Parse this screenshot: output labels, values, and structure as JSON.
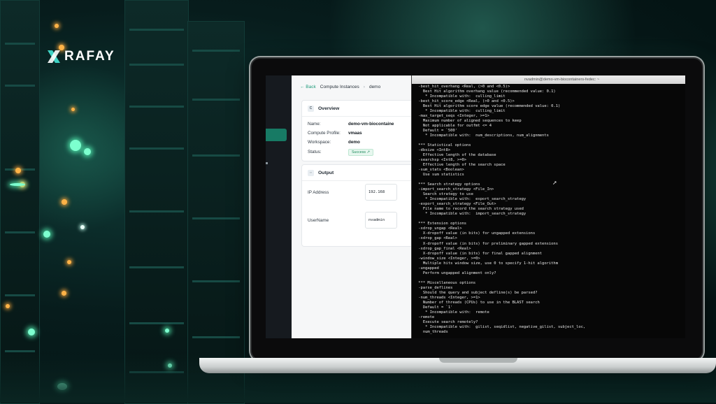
{
  "brand": {
    "name": "RAFAY"
  },
  "console": {
    "breadcrumb": {
      "back": "← Back",
      "section": "Compute Instances",
      "current": "demo"
    },
    "overview": {
      "title": "Overview",
      "rows": [
        {
          "label": "Name:",
          "value": "demo-vm-biocontaine"
        },
        {
          "label": "Compute Profile:",
          "value": "vmaas"
        },
        {
          "label": "Workspace:",
          "value": "demo"
        }
      ],
      "status_label": "Status:",
      "status_value": "Success ↗"
    },
    "output": {
      "title": "Output",
      "ip_label": "IP Address",
      "ip_value": "192.168",
      "user_label": "UserName",
      "user_value": "nvadmin"
    }
  },
  "terminal": {
    "title": "nvadmin@demo-vm-biocontainers-fedec: ~",
    "lines": [
      " -best_hit_overhang <Real, (>0 and <0.5)>",
      "   Best Hit algorithm overhang value (recommended value: 0.1)",
      "    * Incompatible with:  culling_limit",
      " -best_hit_score_edge <Real, (>0 and <0.5)>",
      "   Best Hit algorithm score edge value (recommended value: 0.1)",
      "    * Incompatible with:  culling_limit",
      " -max_target_seqs <Integer, >=1>",
      "   Maximum number of aligned sequences to keep",
      "   Not applicable for outfmt <= 4",
      "   Default = `500'",
      "    * Incompatible with:  num_descriptions, num_alignments",
      "",
      " *** Statistical options",
      " -dbsize <Int8>",
      "   Effective length of the database",
      " -searchsp <Int8, >=0>",
      "   Effective length of the search space",
      " -sum_stats <Boolean>",
      "   Use sum statistics",
      "",
      " *** Search strategy options",
      " -import_search_strategy <File_In>",
      "   Search strategy to use",
      "    * Incompatible with:  export_search_strategy",
      " -export_search_strategy <File_Out>",
      "   File name to record the search strategy used",
      "    * Incompatible with:  import_search_strategy",
      "",
      " *** Extension options",
      " -xdrop_ungap <Real>",
      "   X-dropoff value (in bits) for ungapped extensions",
      " -xdrop_gap <Real>",
      "   X-dropoff value (in bits) for preliminary gapped extensions",
      " -xdrop_gap_final <Real>",
      "   X-dropoff value (in bits) for final gapped alignment",
      " -window_size <Integer, >=0>",
      "   Multiple hits window size, use 0 to specify 1-hit algorithm",
      " -ungapped",
      "   Perform ungapped alignment only?",
      "",
      " *** Miscellaneous options",
      " -parse_deflines",
      "   Should the query and subject defline(s) be parsed?",
      " -num_threads <Integer, >=1>",
      "   Number of threads (CPUs) to use in the BLAST search",
      "   Default = `1'",
      "    * Incompatible with:  remote",
      " -remote",
      "   Execute search remotely?",
      "    * Incompatible with:  gilist, seqidlist, negative_gilist, subject_loc,",
      "   num_threads"
    ]
  }
}
